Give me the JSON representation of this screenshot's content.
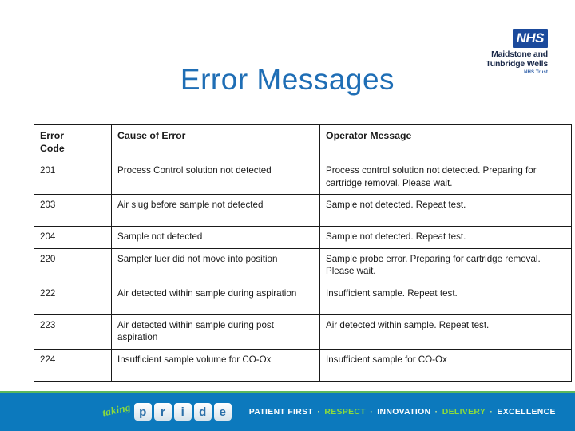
{
  "logo": {
    "nhs_mark": "NHS",
    "trust_name_line1": "Maidstone and",
    "trust_name_line2": "Tunbridge Wells",
    "trust_sub": "NHS Trust",
    "nhs_blue": "#1b4a9c"
  },
  "title": "Error Messages",
  "title_color": "#1f6eb5",
  "table": {
    "columns": [
      "Error Code",
      "Cause of Error",
      "Operator Message"
    ],
    "column_header_code_line1": "Error",
    "column_header_code_line2": "Code",
    "rows": [
      {
        "code": "201",
        "cause": "Process Control solution not detected",
        "message": "Process control solution not detected. Preparing for cartridge removal. Please wait."
      },
      {
        "code": "203",
        "cause": "Air slug before sample not detected",
        "message": "Sample not detected. Repeat test."
      },
      {
        "code": "204",
        "cause": "Sample not detected",
        "message": "Sample not detected. Repeat test."
      },
      {
        "code": "220",
        "cause": "Sampler luer did not move into position",
        "message": "Sample probe error. Preparing for cartridge removal. Please wait."
      },
      {
        "code": "222",
        "cause": "Air detected within sample during aspiration",
        "message": "Insufficient sample. Repeat test."
      },
      {
        "code": "223",
        "cause": "Air detected within sample during post aspiration",
        "message": "Air detected within sample. Repeat test."
      },
      {
        "code": "224",
        "cause": "Insufficient sample volume for CO-Ox",
        "message": "Insufficient sample for CO-Ox"
      }
    ]
  },
  "banner": {
    "taking": "taking",
    "pride_letters": [
      "p",
      "r",
      "i",
      "d",
      "e"
    ],
    "tagline_parts": [
      {
        "text": "PATIENT FIRST",
        "color": "white"
      },
      {
        "text": "RESPECT",
        "color": "green"
      },
      {
        "text": "INNOVATION",
        "color": "white"
      },
      {
        "text": "DELIVERY",
        "color": "green"
      },
      {
        "text": "EXCELLENCE",
        "color": "white"
      }
    ],
    "separator": "·",
    "background_color": "#0c79bd",
    "accent_color": "#8cdb3c"
  }
}
